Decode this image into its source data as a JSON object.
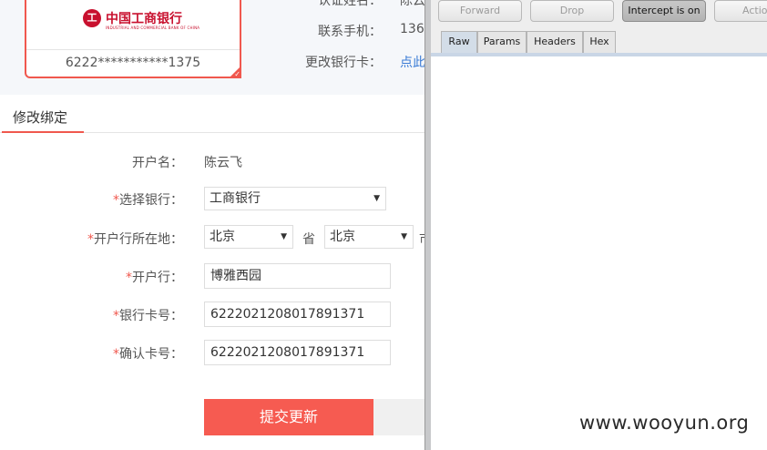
{
  "bank_card": {
    "bank_name": "中国工商银行",
    "bank_name_en": "INDUSTRIAL AND COMMERCIAL BANK OF CHINA",
    "logo_mark": "工",
    "card_number": "6222***********1375",
    "check_icon": "✓"
  },
  "account_info": {
    "name_label": "认证姓名：",
    "name_value": "陈云",
    "phone_label": "联系手机：",
    "phone_value": "136",
    "change_card_label": "更改银行卡：",
    "change_card_link": "点此"
  },
  "section_tab": "修改绑定",
  "form": {
    "holder_label": "开户名：",
    "holder_value": "陈云飞",
    "bank_label": "选择银行：",
    "bank_value": "工商银行",
    "location_label": "开户行所在地：",
    "province_value": "北京",
    "province_suffix": "省",
    "city_value": "北京",
    "city_suffix": "市",
    "branch_label": "开户行：",
    "branch_value": "博雅西园",
    "card_label": "银行卡号：",
    "card_value": "6222021208017891371",
    "confirm_label": "确认卡号：",
    "confirm_value": "6222021208017891371",
    "required_mark": "*",
    "select_arrow": "▼",
    "submit_label": "提交更新"
  },
  "burp": {
    "toolbar": [
      "Forward",
      "Drop",
      "Intercept is on",
      "Action"
    ],
    "tabs": [
      "Raw",
      "Params",
      "Headers",
      "Hex"
    ]
  },
  "watermark": "www.wooyun.org",
  "colors": {
    "accent": "#f65b51",
    "bank_red": "#c8102e",
    "top_band": "#f5f7fa"
  }
}
